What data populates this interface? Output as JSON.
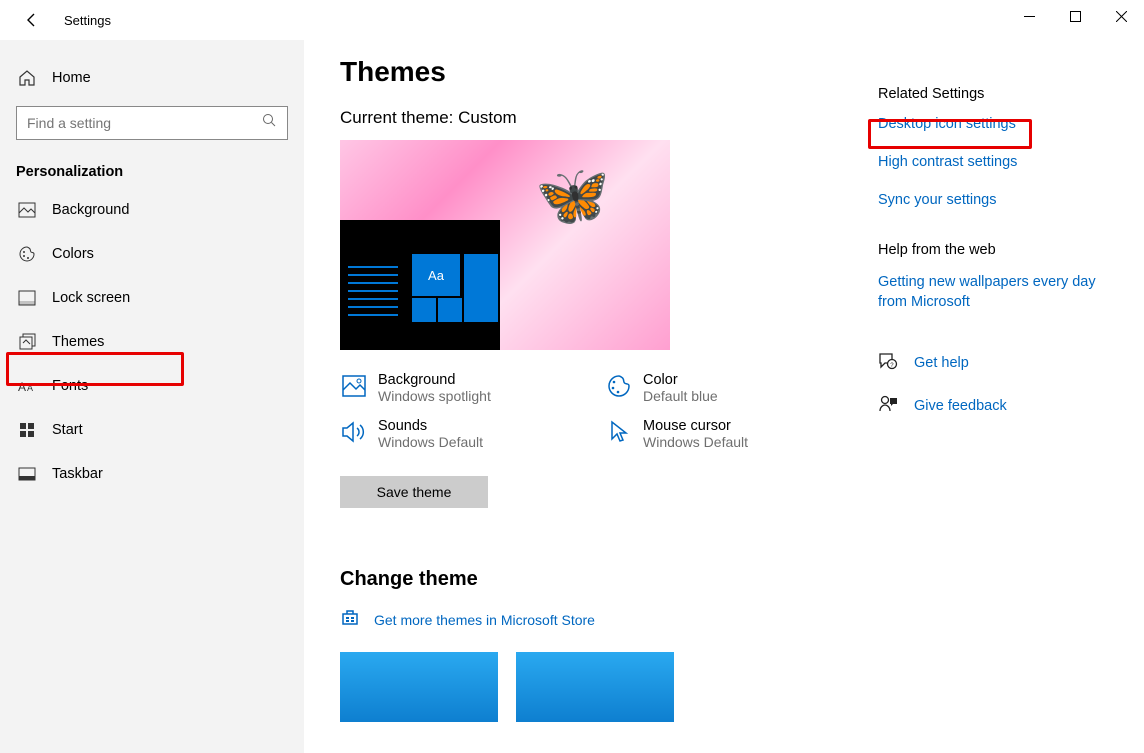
{
  "window": {
    "title": "Settings"
  },
  "sidebar": {
    "home_label": "Home",
    "search_placeholder": "Find a setting",
    "section": "Personalization",
    "items": [
      {
        "label": "Background"
      },
      {
        "label": "Colors"
      },
      {
        "label": "Lock screen"
      },
      {
        "label": "Themes"
      },
      {
        "label": "Fonts"
      },
      {
        "label": "Start"
      },
      {
        "label": "Taskbar"
      }
    ]
  },
  "page": {
    "title": "Themes",
    "current_theme_prefix": "Current theme: ",
    "current_theme_name": "Custom",
    "preview_tile_text": "Aa",
    "props": {
      "background": {
        "title": "Background",
        "value": "Windows spotlight"
      },
      "color": {
        "title": "Color",
        "value": "Default blue"
      },
      "sounds": {
        "title": "Sounds",
        "value": "Windows Default"
      },
      "cursor": {
        "title": "Mouse cursor",
        "value": "Windows Default"
      }
    },
    "save_button": "Save theme",
    "change_theme_heading": "Change theme",
    "store_link": "Get more themes in Microsoft Store"
  },
  "right": {
    "related_heading": "Related Settings",
    "links": {
      "desktop_icon": "Desktop icon settings",
      "high_contrast": "High contrast settings",
      "sync": "Sync your settings"
    },
    "help_heading": "Help from the web",
    "help_link": "Getting new wallpapers every day from Microsoft",
    "get_help": "Get help",
    "give_feedback": "Give feedback"
  }
}
